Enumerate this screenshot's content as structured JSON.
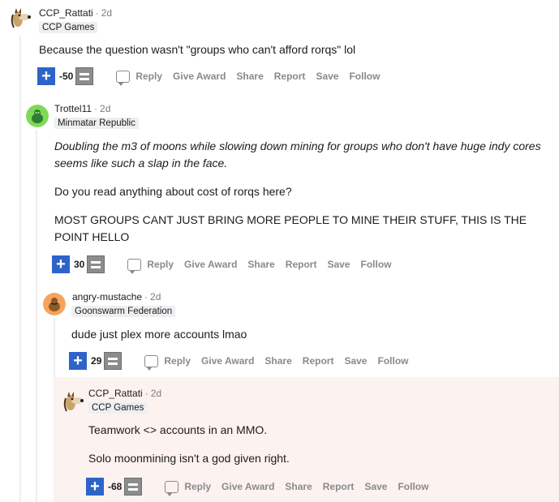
{
  "comments": [
    {
      "author": "CCP_Rattati",
      "time": "2d",
      "flair": "CCP Games",
      "body": [
        "Because the question wasn't \"groups who can't afford rorqs\" lol"
      ],
      "score": "-50",
      "avatar": "horse-avatar-icon"
    },
    {
      "author": "Trottel11",
      "time": "2d",
      "flair": "Minmatar Republic",
      "quote": "Doubling the m3 of moons while slowing down mining for groups who don't have huge indy cores seems like such a slap in the face.",
      "body": [
        "Do you read anything about cost of rorqs here?",
        "MOST GROUPS CANT JUST BRING MORE PEOPLE TO MINE THEIR STUFF, THIS IS THE POINT HELLO"
      ],
      "score": "30",
      "avatar": "green-snoo-avatar-icon"
    },
    {
      "author": "angry-mustache",
      "time": "2d",
      "flair": "Goonswarm Federation",
      "body": [
        "dude just plex more accounts lmao"
      ],
      "score": "29",
      "avatar": "orange-snoo-avatar-icon"
    },
    {
      "author": "CCP_Rattati",
      "time": "2d",
      "flair": "CCP Games",
      "body": [
        "Teamwork <> accounts in an MMO.",
        "Solo moonmining isn't a god given right."
      ],
      "score": "-68",
      "avatar": "horse-avatar-icon"
    }
  ],
  "actions": {
    "reply": "Reply",
    "give_award": "Give Award",
    "share": "Share",
    "report": "Report",
    "save": "Save",
    "follow": "Follow"
  },
  "separator": "·",
  "colors": {
    "upvote": "#2e64c9",
    "downvote": "#8c8c8c",
    "highlight": "#fcf2ef",
    "meta": "#878a8c"
  }
}
